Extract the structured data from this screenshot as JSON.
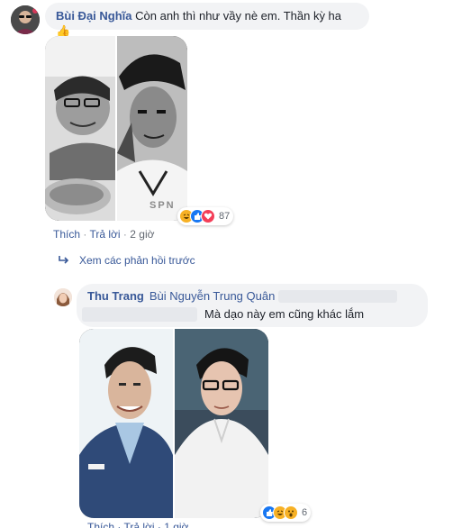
{
  "comment1": {
    "author": "Bùi Đại Nghĩa",
    "text": "Còn anh thì như vầy nè em. Thần kỳ ha",
    "thumb_emoji": "👍",
    "reaction_count": "87",
    "actions": {
      "like": "Thích",
      "reply": "Trả lời",
      "time": "2 giờ"
    },
    "photo_watermark": "SPN"
  },
  "more_replies": {
    "label": "Xem các phản hồi trước"
  },
  "reply1": {
    "author": "Thu Trang",
    "mention": "Bùi Nguyễn Trung Quân",
    "text": "Mà dạo này em cũng khác lắm",
    "reaction_count": "6",
    "actions_partial": "Thích · Trả lời · 1 giờ"
  },
  "colors": {
    "link_blue": "#385898",
    "bubble_bg": "#f2f3f5",
    "meta_gray": "#616770",
    "like_blue": "#1877f2",
    "haha_yellow": "#f7b125",
    "love_red": "#f33e58"
  },
  "icons": {
    "reply_arrow": "reply-arrow-icon",
    "like": "like-reaction-icon",
    "haha": "haha-reaction-icon",
    "love": "love-reaction-icon",
    "wow": "wow-reaction-icon"
  }
}
